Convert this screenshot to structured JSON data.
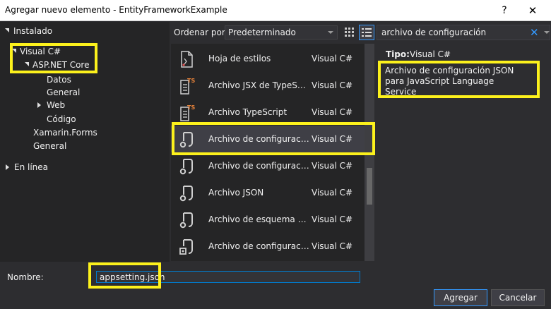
{
  "window": {
    "title": "Agregar nuevo elemento - EntityFrameworkExample",
    "help_glyph": "?",
    "close_glyph": "✕"
  },
  "tree": {
    "installed": "Instalado",
    "visual_csharp": "Visual C#",
    "aspnet_core": "ASP.NET Core",
    "datos": "Datos",
    "general_sub": "General",
    "web": "Web",
    "codigo": "Código",
    "xamarin": "Xamarin.Forms",
    "general": "General",
    "online": "En línea"
  },
  "toolbar": {
    "sort_label": "Ordenar por:",
    "sort_value": "Predeterminado",
    "grid_icon": "grid-view-icon",
    "list_icon": "list-view-icon"
  },
  "templates": [
    {
      "name": "Hoja de estilos",
      "lang": "Visual C#",
      "icon": "stylesheet-icon"
    },
    {
      "name": "Archivo JSX de TypeScript",
      "lang": "Visual C#",
      "icon": "typescript-file-icon"
    },
    {
      "name": "Archivo TypeScript",
      "lang": "Visual C#",
      "icon": "typescript-file-icon"
    },
    {
      "name": "Archivo de configuración JSON para JavaScript Language Service",
      "lang": "Visual C#",
      "icon": "json-file-icon"
    },
    {
      "name": "Archivo de configuración de TypeScript",
      "lang": "Visual C#",
      "icon": "json-file-icon"
    },
    {
      "name": "Archivo JSON",
      "lang": "Visual C#",
      "icon": "json-file-icon"
    },
    {
      "name": "Archivo de esquema de JSON",
      "lang": "Visual C#",
      "icon": "json-file-icon"
    },
    {
      "name": "Archivo de configuración de npm",
      "lang": "Visual C#",
      "icon": "npm-config-icon"
    }
  ],
  "search": {
    "value": "archivo de configuración",
    "clear_glyph": "✕"
  },
  "details": {
    "type_label": "Tipo:",
    "type_value": "Visual C#",
    "description": "Archivo de configuración JSON para JavaScript Language Service"
  },
  "bottom": {
    "name_label": "Nombre:",
    "name_value": "appsetting.json",
    "add_label": "Agregar",
    "cancel_label": "Cancelar"
  },
  "colors": {
    "highlight": "#fcf11c",
    "accent": "#3399ff",
    "selected_row": "#3f3f46",
    "background": "#2d2d30"
  }
}
